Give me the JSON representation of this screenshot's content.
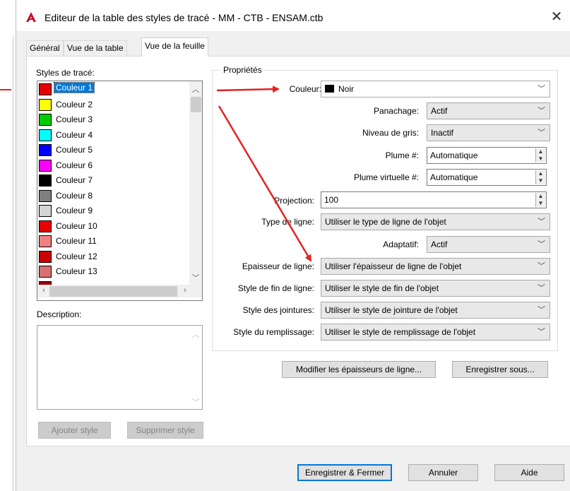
{
  "window": {
    "title": "Editeur de la table des styles de tracé - MM - CTB - ENSAM.ctb",
    "close_glyph": "✕"
  },
  "tabs": [
    {
      "label": "Général",
      "active": false
    },
    {
      "label": "Vue de la table",
      "active": false
    },
    {
      "label": "Vue de la feuille",
      "active": true
    }
  ],
  "styles_panel": {
    "label": "Styles de tracé:",
    "items": [
      {
        "label": "Couleur 1",
        "color": "#e60000",
        "selected": true
      },
      {
        "label": "Couleur 2",
        "color": "#ffff00"
      },
      {
        "label": "Couleur 3",
        "color": "#00cc00"
      },
      {
        "label": "Couleur 4",
        "color": "#00ffff"
      },
      {
        "label": "Couleur 5",
        "color": "#0000ff"
      },
      {
        "label": "Couleur 6",
        "color": "#ff00ff"
      },
      {
        "label": "Couleur 7",
        "color": "#000000"
      },
      {
        "label": "Couleur 8",
        "color": "#808080"
      },
      {
        "label": "Couleur 9",
        "color": "#d4d4d4"
      },
      {
        "label": "Couleur 10",
        "color": "#e60000"
      },
      {
        "label": "Couleur 11",
        "color": "#f08080"
      },
      {
        "label": "Couleur 12",
        "color": "#cc0000"
      },
      {
        "label": "Couleur 13",
        "color": "#d97070"
      },
      {
        "label": "",
        "color": "#990000"
      }
    ]
  },
  "description": {
    "label": "Description:",
    "value": ""
  },
  "style_buttons": {
    "add": "Ajouter style",
    "delete": "Supprimer style"
  },
  "properties": {
    "legend": "Propriétés",
    "color": {
      "label": "Couleur:",
      "value": "Noir"
    },
    "dithering": {
      "label": "Panachage:",
      "value": "Actif"
    },
    "grayscale": {
      "label": "Niveau de gris:",
      "value": "Inactif"
    },
    "pen": {
      "label": "Plume #:",
      "value": "Automatique"
    },
    "virtual_pen": {
      "label": "Plume virtuelle #:",
      "value": "Automatique"
    },
    "screening": {
      "label": "Projection:",
      "value": "100"
    },
    "linetype": {
      "label": "Type de ligne:",
      "value": "Utiliser le type de ligne de l'objet"
    },
    "adaptive": {
      "label": "Adaptatif:",
      "value": "Actif"
    },
    "lineweight": {
      "label": "Epaisseur de ligne:",
      "value": "Utiliser l'épaisseur de ligne de l'objet"
    },
    "line_end": {
      "label": "Style de fin de ligne:",
      "value": "Utiliser le style de fin de l'objet"
    },
    "line_join": {
      "label": "Style des jointures:",
      "value": "Utiliser le style de jointure de l'objet"
    },
    "fill": {
      "label": "Style du remplissage:",
      "value": "Utiliser le style de remplissage de l'objet"
    }
  },
  "panel_buttons": {
    "edit_lineweights": "Modifier les épaisseurs de ligne...",
    "save_as": "Enregistrer sous..."
  },
  "footer": {
    "save_close": "Enregistrer & Fermer",
    "cancel": "Annuler",
    "help": "Aide"
  },
  "colors": {
    "annotation_arrow": "#e32222",
    "selection": "#0078d7",
    "app_icon": "#c8102e"
  }
}
